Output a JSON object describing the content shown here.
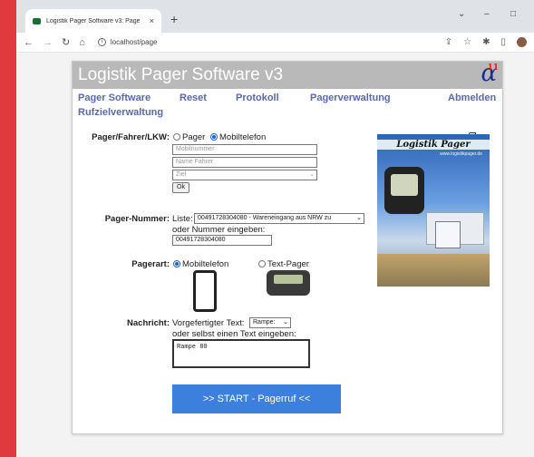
{
  "browser": {
    "tab_title": "Logistik Pager Software v3: Page",
    "tab_close": "×",
    "new_tab": "+",
    "url": "localhost/page",
    "controls": {
      "minimize": "–",
      "maximize": "□",
      "menu": "⌄"
    }
  },
  "app": {
    "title": "Logistik Pager Software v3",
    "logo": "α",
    "logo_sup": "11",
    "menu": {
      "pager_software": "Pager Software",
      "reset": "Reset",
      "protokoll": "Protokoll",
      "pagerverwaltung": "Pagerverwaltung",
      "abmelden": "Abmelden",
      "rufzielverwaltung": "Rufzielverwaltung"
    }
  },
  "form": {
    "pager_fahrer_label": "Pager/Fahrer/LKW:",
    "radio_pager": "Pager",
    "radio_mobil": "Mobiltelefon",
    "mobil_placeholder": "Mobilnummer",
    "name_placeholder": "Name Fahrer",
    "ziel_placeholder": "Ziel",
    "ok_label": "Ok",
    "pager_nummer_label": "Pager-Nummer:",
    "liste_label": "Liste:",
    "liste_value": "00491728304080 - Wareneingang aus NRW zu",
    "oder_nummer": "oder Nummer eingeben:",
    "nummer_value": "00491728304080",
    "pagerart_label": "Pagerart:",
    "pagerart_mobil": "Mobiltelefon",
    "pagerart_text": "Text-Pager",
    "nachricht_label": "Nachricht:",
    "vorgefertigter": "Vorgefertigter Text:",
    "vorgefertigter_value": "Rampe:",
    "oder_selbst": "oder selbst einen Text eingeben:",
    "nachricht_value": "Rampe 80",
    "start_button": ">> START - Pagerruf <<"
  },
  "promo": {
    "title": "Logistik Pager",
    "url": "www.logistikpager.de"
  }
}
